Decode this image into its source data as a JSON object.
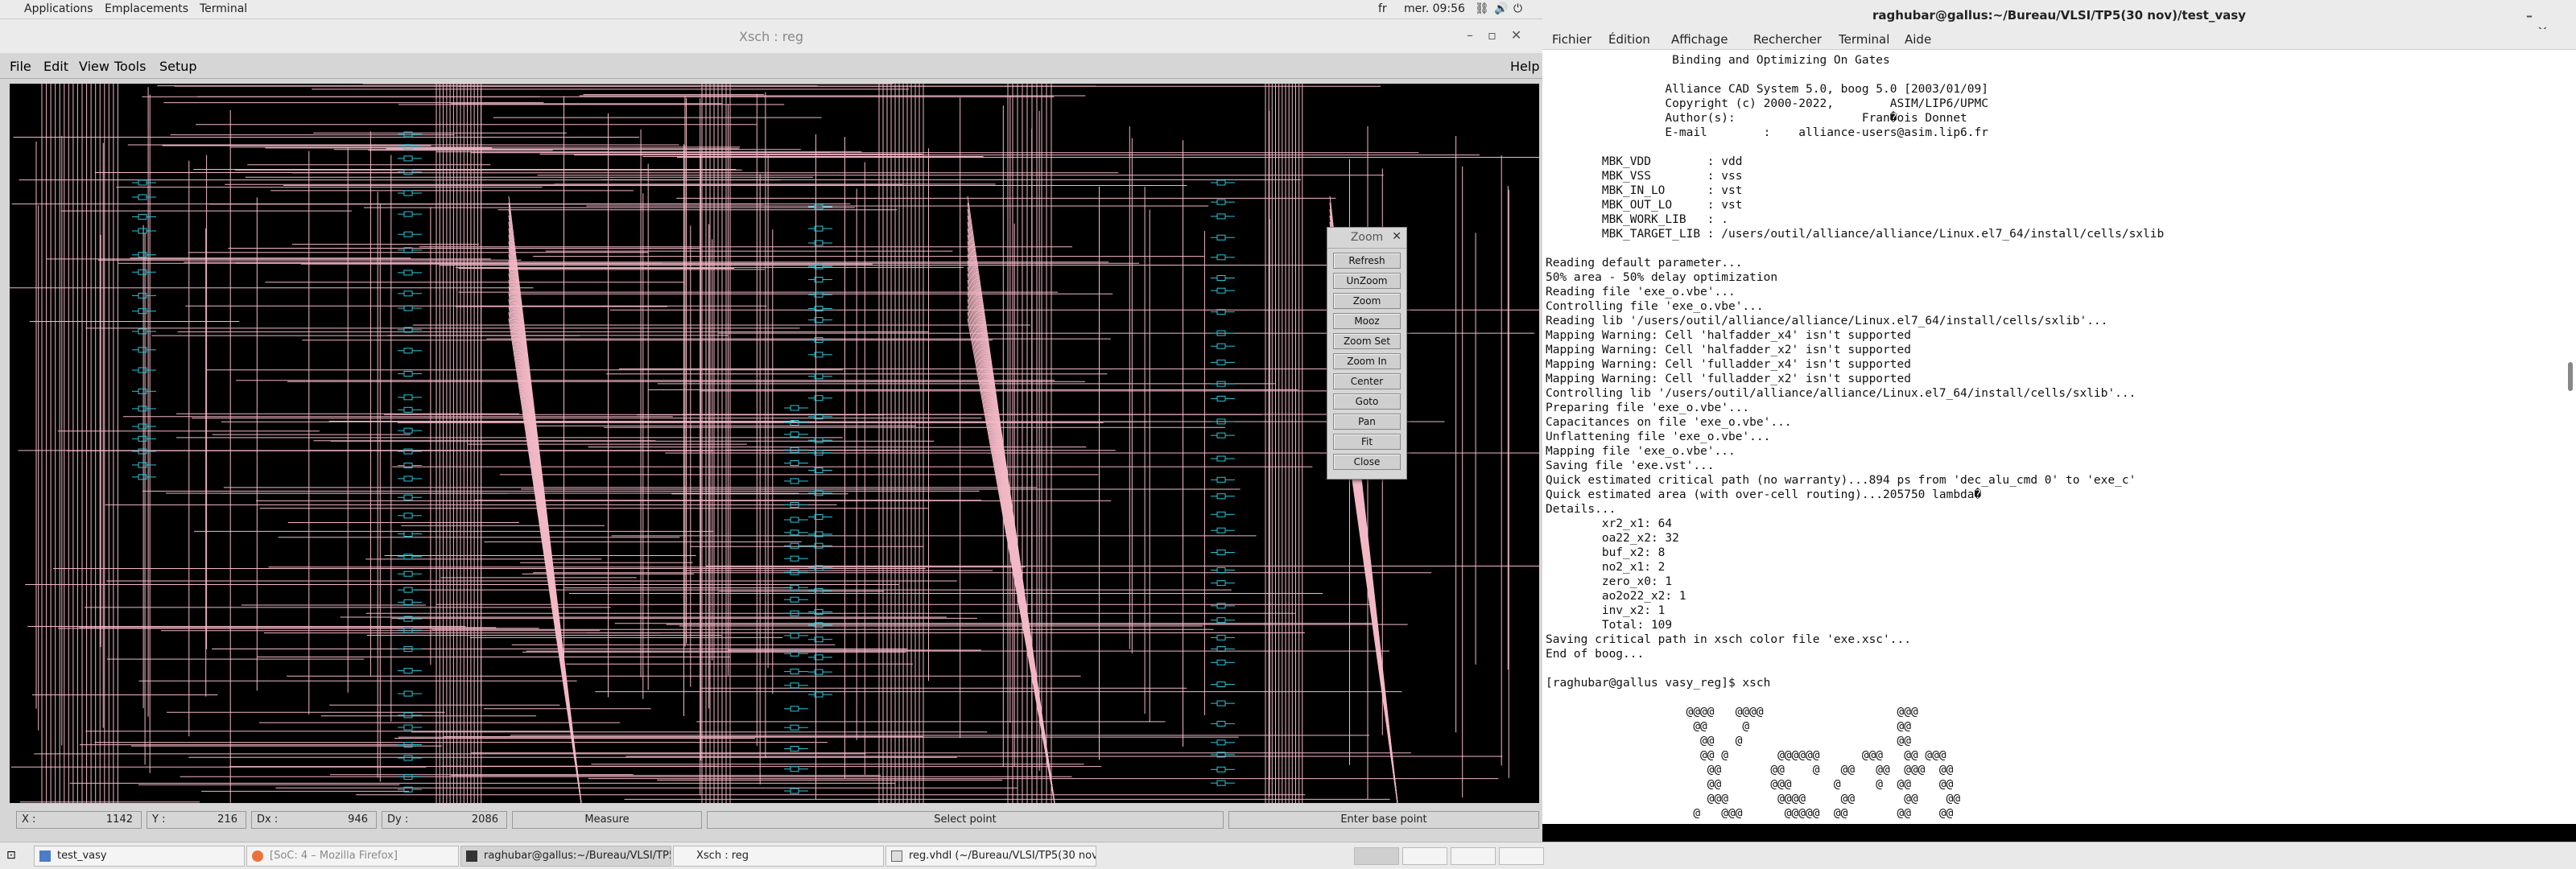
{
  "topbar": {
    "applications": "Applications",
    "places": "Emplacements",
    "terminal": "Terminal",
    "lang": "fr",
    "clock": "mer. 09:56"
  },
  "xsch": {
    "title": "Xsch : reg",
    "menu": {
      "file": "File",
      "edit": "Edit",
      "view": "View",
      "tools": "Tools",
      "setup": "Setup",
      "help": "Help"
    },
    "status": {
      "x_label": "X :",
      "x_value": "1142",
      "y_label": "Y :",
      "y_value": "216",
      "dx_label": "Dx :",
      "dx_value": "946",
      "dy_label": "Dy :",
      "dy_value": "2086",
      "measure": "Measure",
      "select": "Select point",
      "enter": "Enter base point"
    },
    "zoom": {
      "title": "Zoom",
      "buttons": [
        "Refresh",
        "UnZoom",
        "Zoom",
        "Mooz",
        "Zoom Set",
        "Zoom In",
        "Center",
        "Goto",
        "Pan",
        "Fit",
        "Close"
      ]
    },
    "colors": {
      "wire": "#f2b8c6",
      "cell": "#29c6d6",
      "background": "#000000"
    }
  },
  "terminal": {
    "title": "raghubar@gallus:~/Bureau/VLSI/TP5(30 nov)/test_vasy",
    "menu": {
      "file": "Fichier",
      "edit": "Édition",
      "view": "Affichage",
      "search": "Rechercher",
      "terminal": "Terminal",
      "help": "Aide"
    },
    "lines": [
      "                  Binding and Optimizing On Gates",
      "",
      "                 Alliance CAD System 5.0, boog 5.0 [2003/01/09]",
      "                 Copyright (c) 2000-2022,        ASIM/LIP6/UPMC",
      "                 Author(s):                  Fran�ois Donnet",
      "                 E-mail        :    alliance-users@asim.lip6.fr",
      "",
      "        MBK_VDD        : vdd",
      "        MBK_VSS        : vss",
      "        MBK_IN_LO      : vst",
      "        MBK_OUT_LO     : vst",
      "        MBK_WORK_LIB   : .",
      "        MBK_TARGET_LIB : /users/outil/alliance/alliance/Linux.el7_64/install/cells/sxlib",
      "",
      "Reading default parameter...",
      "50% area - 50% delay optimization",
      "Reading file 'exe_o.vbe'...",
      "Controlling file 'exe_o.vbe'...",
      "Reading lib '/users/outil/alliance/alliance/Linux.el7_64/install/cells/sxlib'...",
      "Mapping Warning: Cell 'halfadder_x4' isn't supported",
      "Mapping Warning: Cell 'halfadder_x2' isn't supported",
      "Mapping Warning: Cell 'fulladder_x4' isn't supported",
      "Mapping Warning: Cell 'fulladder_x2' isn't supported",
      "Controlling lib '/users/outil/alliance/alliance/Linux.el7_64/install/cells/sxlib'...",
      "Preparing file 'exe_o.vbe'...",
      "Capacitances on file 'exe_o.vbe'...",
      "Unflattening file 'exe_o.vbe'...",
      "Mapping file 'exe_o.vbe'...",
      "Saving file 'exe.vst'...",
      "Quick estimated critical path (no warranty)...894 ps from 'dec_alu_cmd 0' to 'exe_c'",
      "Quick estimated area (with over-cell routing)...205750 lambda�",
      "Details...",
      "        xr2_x1: 64",
      "        oa22_x2: 32",
      "        buf_x2: 8",
      "        no2_x1: 2",
      "        zero_x0: 1",
      "        ao2o22_x2: 1",
      "        inv_x2: 1",
      "        Total: 109",
      "Saving critical path in xsch color file 'exe.xsc'...",
      "End of boog...",
      "",
      "[raghubar@gallus vasy_reg]$ xsch",
      "",
      "                    @@@@   @@@@                   @@@",
      "                     @@     @                     @@",
      "                      @@   @                      @@",
      "                      @@ @       @@@@@@      @@@   @@ @@@",
      "                       @@       @@    @   @@   @@  @@@  @@",
      "                       @@       @@@      @     @  @@    @@",
      "                       @@@       @@@@     @@       @@    @@",
      "                     @   @@@      @@@@@  @@       @@    @@"
    ]
  },
  "taskbar": {
    "items": [
      {
        "label": "test_vasy",
        "active": false
      },
      {
        "label": "[SoC: 4 – Mozilla Firefox]",
        "active": false
      },
      {
        "label": "raghubar@gallus:~/Bureau/VLSI/TP5...",
        "active": true
      },
      {
        "label": "Xsch : reg",
        "active": false
      },
      {
        "label": "reg.vhdl (~/Bureau/VLSI/TP5(30 nov...",
        "active": false
      }
    ]
  }
}
